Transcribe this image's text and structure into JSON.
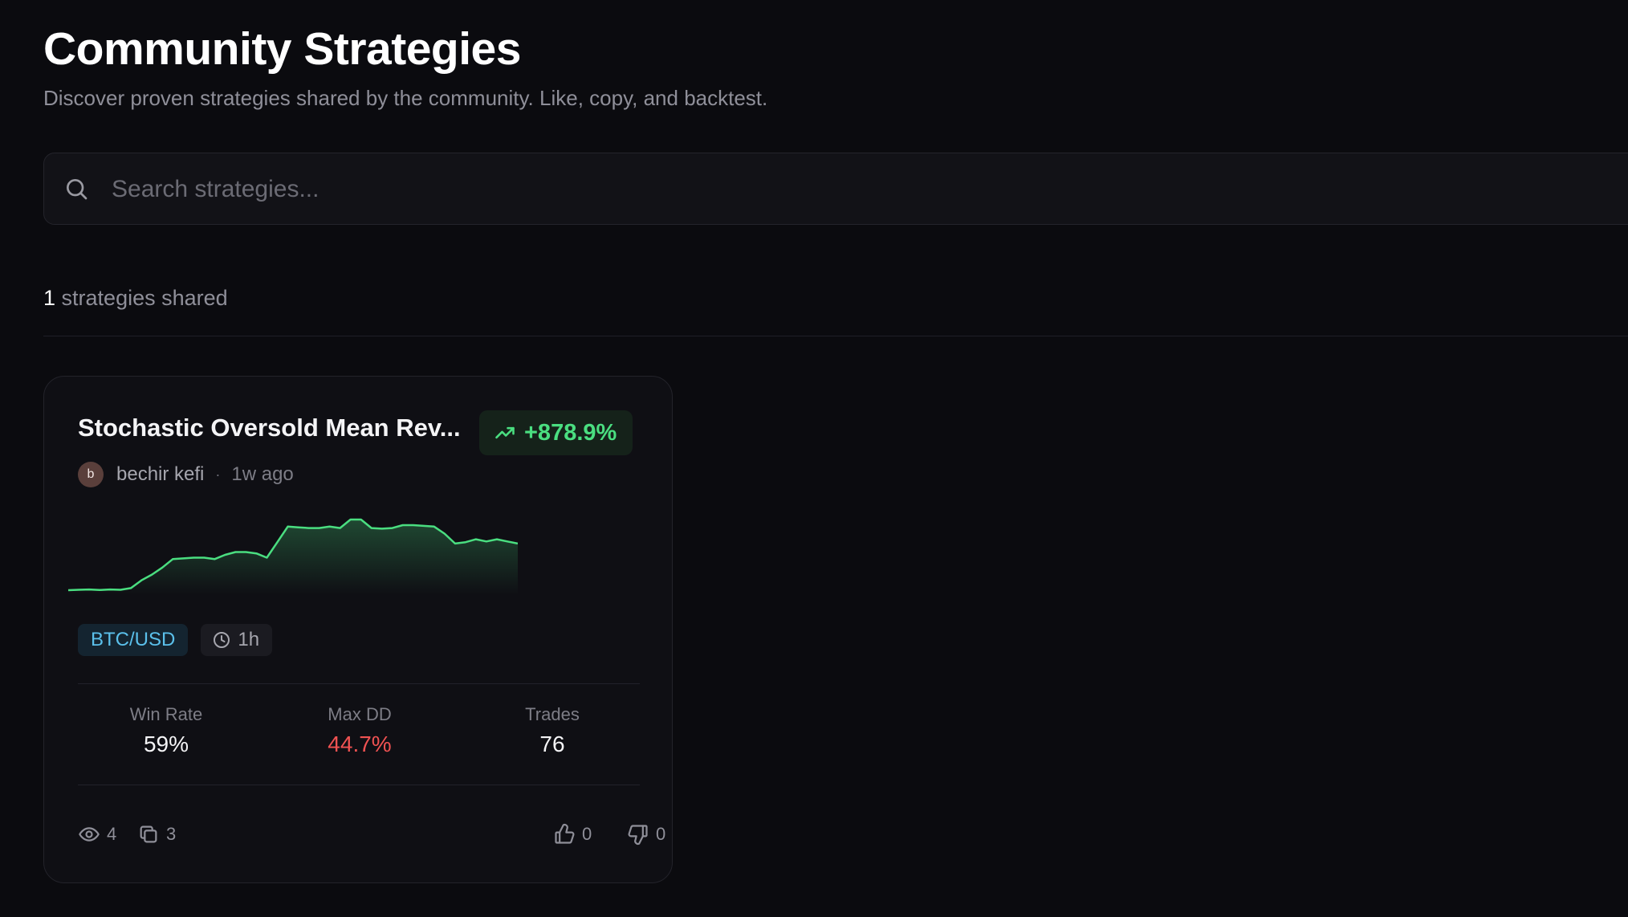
{
  "header": {
    "title": "Community Strategies",
    "subtitle": "Discover proven strategies shared by the community. Like, copy, and backtest."
  },
  "search": {
    "placeholder": "Search strategies...",
    "value": ""
  },
  "summary": {
    "count": "1",
    "label": "strategies shared"
  },
  "strategies": [
    {
      "title": "Stochastic Oversold Mean Rev...",
      "return_pct": "+878.9%",
      "author_initial": "b",
      "author": "bechir kefi",
      "separator": "·",
      "posted": "1w ago",
      "pair": "BTC/USD",
      "timeframe": "1h",
      "stats": {
        "win_rate_label": "Win Rate",
        "win_rate": "59%",
        "max_dd_label": "Max DD",
        "max_dd": "44.7%",
        "trades_label": "Trades",
        "trades": "76"
      },
      "views": "4",
      "copies": "3",
      "likes": "0",
      "dislikes": "0",
      "equity_curve": [
        0,
        0.3,
        0.5,
        0.1,
        0.5,
        0.3,
        1.5,
        7,
        11,
        16,
        22,
        22.5,
        23,
        23,
        22,
        25,
        27,
        27,
        26,
        23,
        34,
        45,
        44.5,
        44,
        44,
        45,
        44,
        50,
        50,
        44,
        43.5,
        44,
        46,
        46,
        45.5,
        45,
        40,
        33,
        34,
        36,
        34.5,
        36,
        34.5,
        33
      ]
    }
  ],
  "colors": {
    "accent_green": "#4ade80",
    "danger_red": "#f05252",
    "pair_blue": "#5bc0eb",
    "background": "#0b0b0f"
  },
  "icons": {
    "search": "search-icon",
    "trend": "trending-up-icon",
    "clock": "clock-icon",
    "views": "eye-icon",
    "copies": "copy-icon",
    "likes": "thumbs-up-icon",
    "dislikes": "thumbs-down-icon"
  }
}
